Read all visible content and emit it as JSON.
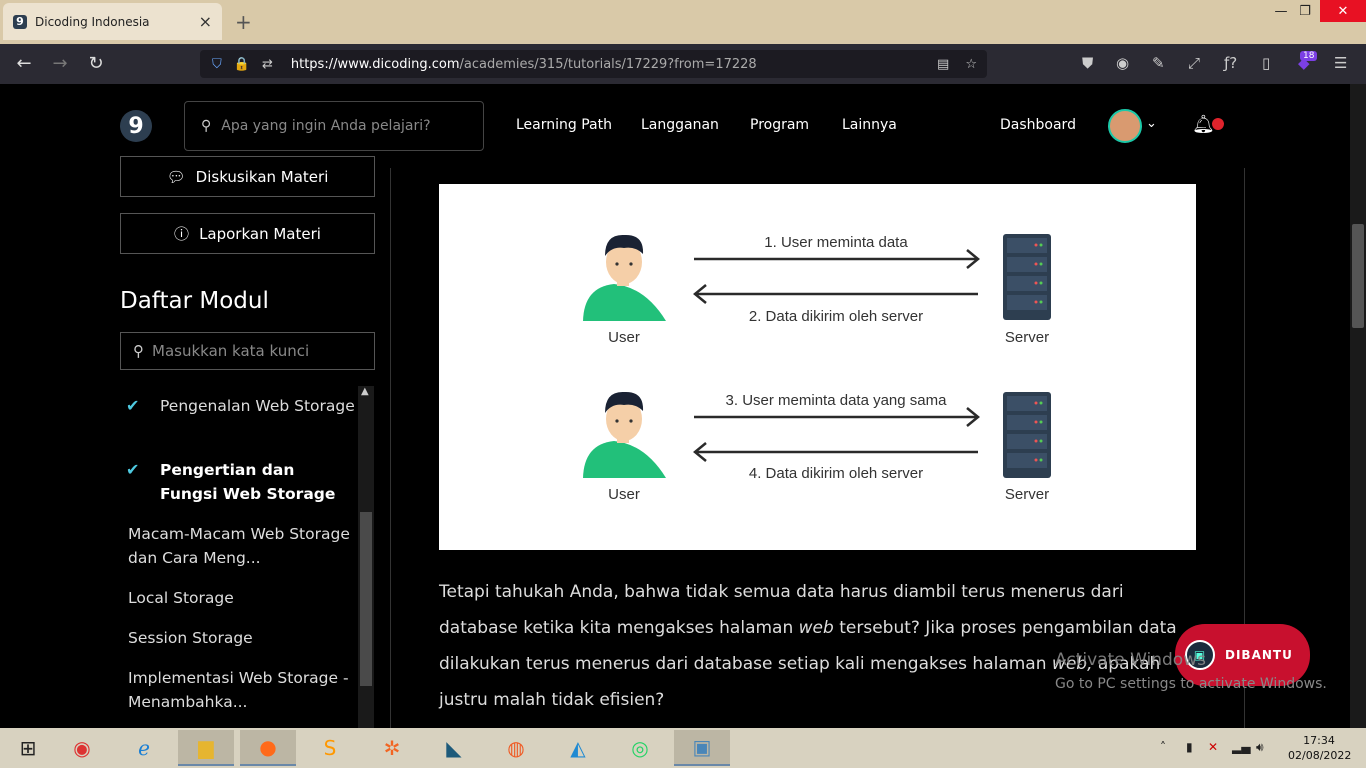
{
  "browser": {
    "tab_title": "Dicoding Indonesia",
    "tab_favicon": "9",
    "url_domain": "https://www.dicoding.com",
    "url_path": "/academies/315/tutorials/17229?from=17228",
    "extension_badge": "18"
  },
  "header": {
    "logo": "9",
    "search_placeholder": "Apa yang ingin Anda pelajari?",
    "nav": [
      "Learning Path",
      "Langganan",
      "Program",
      "Lainnya"
    ],
    "dashboard": "Dashboard"
  },
  "sidebar": {
    "discuss_button": "Diskusikan Materi",
    "report_button": "Laporkan Materi",
    "module_title": "Daftar Modul",
    "module_search_placeholder": "Masukkan kata kunci",
    "modules": [
      {
        "label": "Pengenalan Web Storage",
        "done": true,
        "active": false
      },
      {
        "label": "Pengertian dan Fungsi Web Storage",
        "done": true,
        "active": true
      },
      {
        "label": "Macam-Macam Web Storage dan Cara Meng...",
        "done": false,
        "active": false
      },
      {
        "label": "Local Storage",
        "done": false,
        "active": false
      },
      {
        "label": "Session Storage",
        "done": false,
        "active": false
      },
      {
        "label": "Implementasi Web Storage - Menambahka...",
        "done": false,
        "active": false
      }
    ]
  },
  "illustration": {
    "step1": "1. User meminta data",
    "step2": "2. Data dikirim oleh server",
    "step3": "3. User meminta data yang sama",
    "step4": "4. Data dikirim oleh server",
    "user_label": "User",
    "server_label": "Server"
  },
  "content": {
    "p1": "Tetapi tahukah Anda, bahwa tidak semua data harus diambil terus menerus dari database ketika kita mengakses halaman",
    "p1_em": "web",
    "p2": "tersebut? Jika proses pengambilan data dilakukan terus menerus dari database setiap kali mengakses halaman",
    "p2_em": "web,",
    "p3": "apakah justru malah tidak efisien?"
  },
  "widgets": {
    "dibantu": "DIBANTU",
    "activate_title": "Activate Windows",
    "activate_sub": "Go to PC settings to activate Windows."
  },
  "taskbar": {
    "time": "17:34",
    "date": "02/08/2022"
  },
  "colors": {
    "accent_check": "#4ec9e0",
    "shirt_green": "#22c07a",
    "server_navy": "#2d3e50",
    "dibantu_red": "#c8102e"
  }
}
